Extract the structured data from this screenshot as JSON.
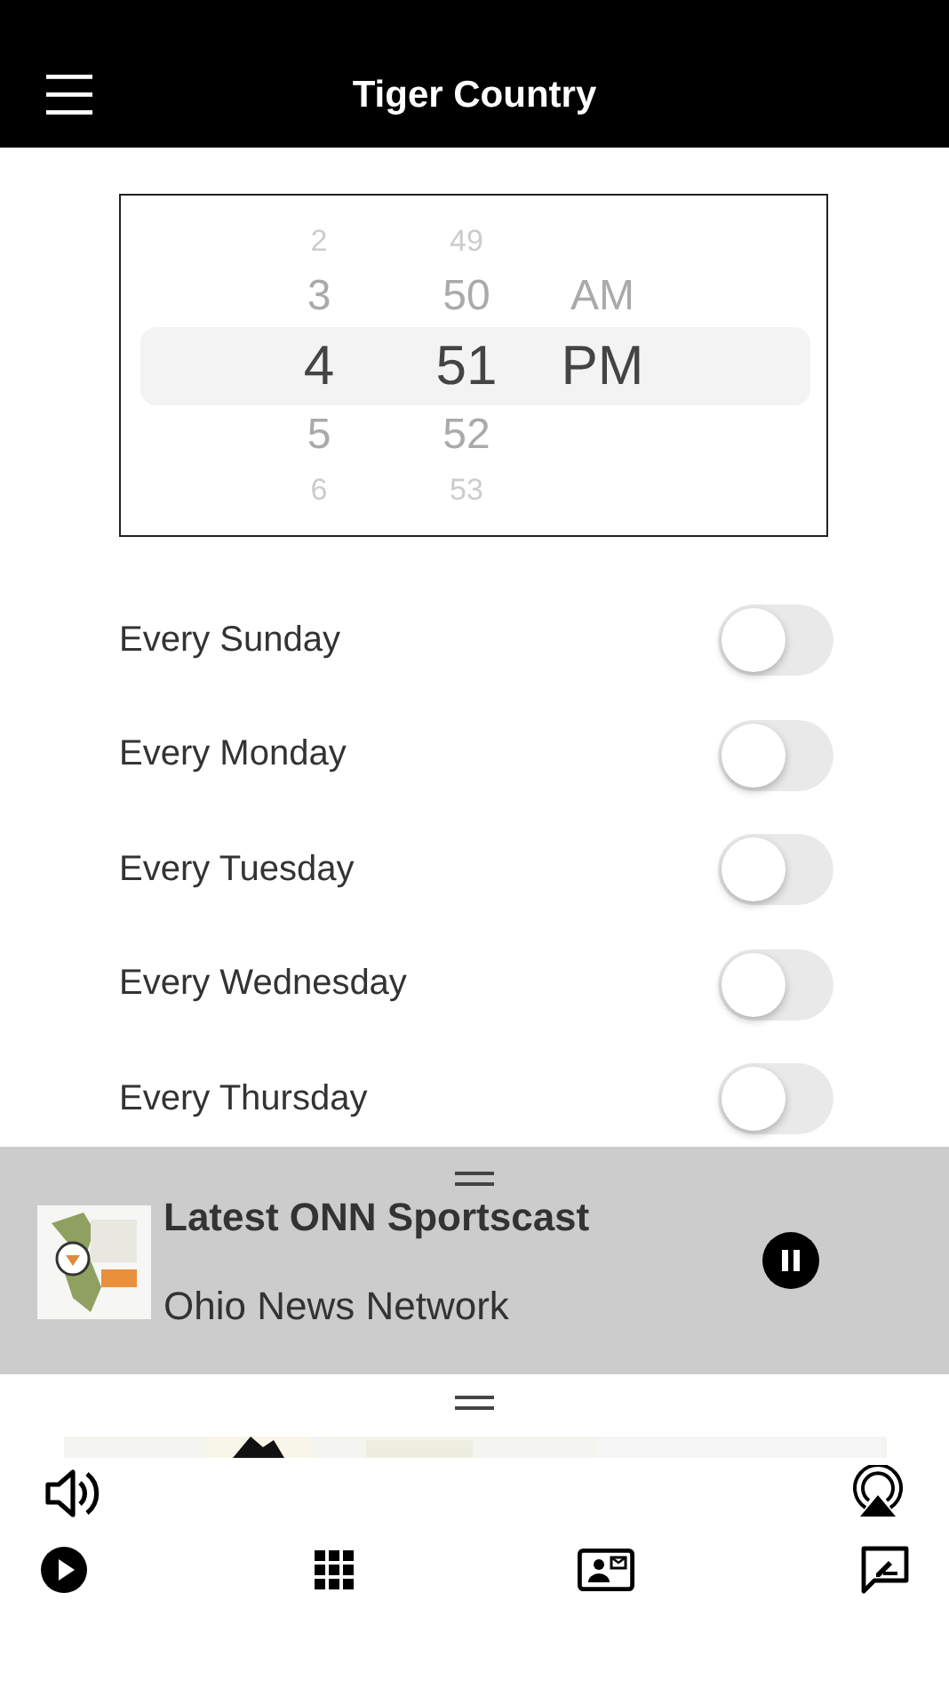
{
  "header": {
    "title": "Tiger Country"
  },
  "time_picker": {
    "columns": [
      {
        "items": [
          {
            "text": "2",
            "selected": false
          },
          {
            "text": "3",
            "selected": false
          },
          {
            "text": "4",
            "selected": true
          },
          {
            "text": "5",
            "selected": false
          },
          {
            "text": "6",
            "selected": false
          }
        ]
      },
      {
        "items": [
          {
            "text": "49",
            "selected": false
          },
          {
            "text": "50",
            "selected": false
          },
          {
            "text": "51",
            "selected": true
          },
          {
            "text": "52",
            "selected": false
          },
          {
            "text": "53",
            "selected": false
          }
        ]
      },
      {
        "items": [
          {
            "text": "AM",
            "selected": false
          },
          {
            "text": "PM",
            "selected": true
          }
        ]
      }
    ]
  },
  "schedule": [
    {
      "label": "Every Sunday",
      "on": false
    },
    {
      "label": "Every Monday",
      "on": false
    },
    {
      "label": "Every Tuesday",
      "on": false
    },
    {
      "label": "Every Wednesday",
      "on": false
    },
    {
      "label": "Every Thursday",
      "on": false
    }
  ],
  "mini_player": {
    "title": "Latest ONN Sportscast",
    "subtitle": "Ohio News Network",
    "playing": true
  }
}
